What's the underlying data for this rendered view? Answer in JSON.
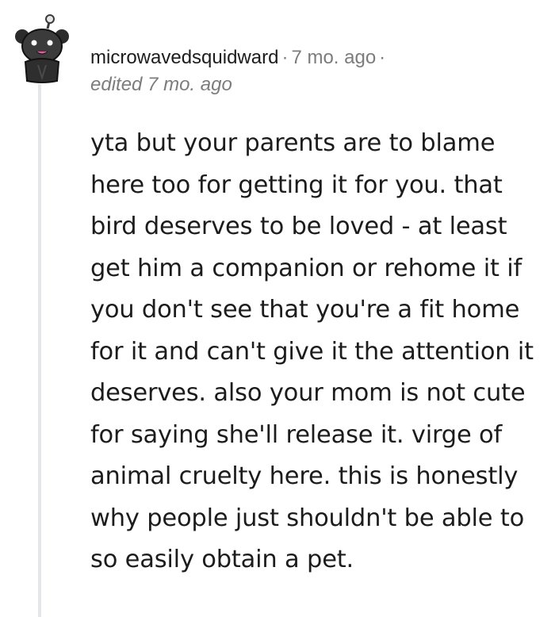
{
  "comment": {
    "author": "microwavedsquidward",
    "separator": "·",
    "age": "7 mo. ago",
    "edited": "edited 7 mo. ago",
    "body_text": "yta but your parents are to blame here too for getting it for you. that bird deserves to be loved - at least get him a companion or rehome it if you don't see that you're a fit home for it and can't give it the attention it deserves. also your mom is not cute for saying she'll release it. virge of animal cruelty here. this is honestly why people just shouldn't be able to so easily obtain a pet."
  },
  "colors": {
    "text_primary": "#1c1c1c",
    "text_meta": "#7c7c7c",
    "thread_line": "#e4e6e8",
    "background": "#ffffff"
  },
  "icons": {
    "avatar": "snoo-avatar"
  }
}
